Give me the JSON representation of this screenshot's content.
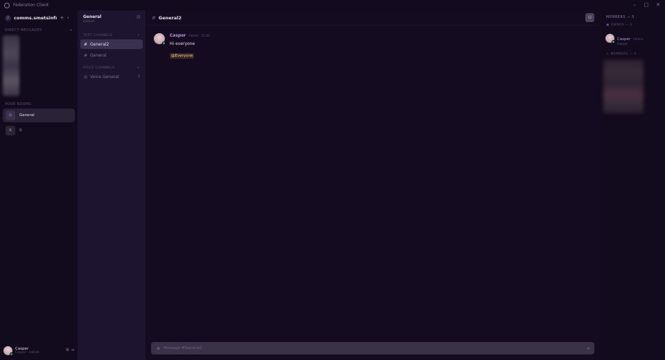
{
  "titlebar": {
    "app_title": "Federation Client",
    "minimize": "–",
    "maximize": "□",
    "close": "✕"
  },
  "server": {
    "icon_letter": "2",
    "name": "comms.smetsinfra.cc",
    "add": "+",
    "collapse": "‹"
  },
  "sidebar": {
    "direct_messages_label": "DIRECT MESSAGES",
    "dm_add": "+",
    "your_rooms_label": "YOUR ROOMS",
    "rooms": [
      {
        "letter": "G",
        "name": "General"
      },
      {
        "letter": "R",
        "name": "R"
      }
    ]
  },
  "user": {
    "name": "Casper",
    "status": "Casper · Hahah",
    "settings_icon": "⚙",
    "logout_icon": "⇥"
  },
  "channels": {
    "header_title": "General",
    "header_sub": "Default",
    "gear": "⚙",
    "text_label": "TEXT CHANNELS",
    "voice_label": "VOICE CHANNELS",
    "add": "+",
    "hash": "#",
    "text_items": [
      "General2",
      "General"
    ],
    "voice_items": [
      {
        "name": "Voice General",
        "count": "1"
      }
    ],
    "voice_icon": "◎"
  },
  "main": {
    "hash": "#",
    "channel_name": "General2",
    "members_button_icon": "⚇",
    "message": {
      "author": "Casper",
      "handle": "Hahah",
      "time": "12:40",
      "text": "Hi everyone",
      "mention": "@Everyone"
    },
    "composer": {
      "clip_icon": "⊕",
      "placeholder": "Message #General2",
      "send_icon": "➤"
    }
  },
  "members": {
    "header": "MEMBERS — 5",
    "owner_label": "OWNER — 1",
    "owner_tag": "▣",
    "owner_name": "Casper",
    "owner_sub": "Hahah",
    "owner_badge": "Online",
    "members_label": "MEMBERS — 4",
    "members_tag": "♙"
  }
}
